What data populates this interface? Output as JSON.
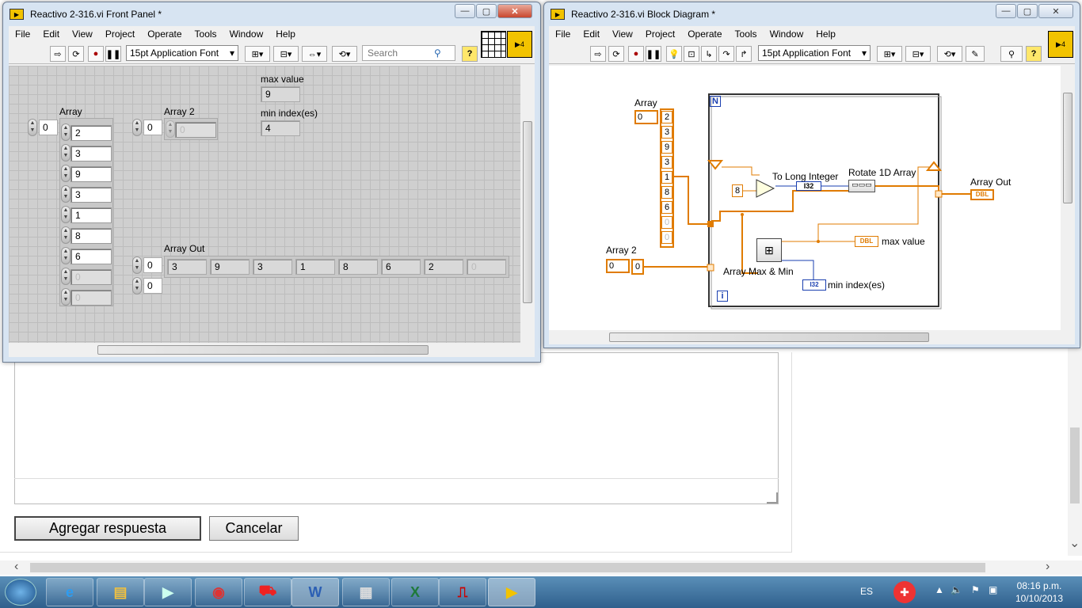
{
  "background_page": {
    "submit_button": "Agregar respuesta",
    "cancel_button": "Cancelar"
  },
  "front_panel": {
    "title": "Reactivo 2-316.vi Front Panel *",
    "menu": [
      "File",
      "Edit",
      "View",
      "Project",
      "Operate",
      "Tools",
      "Window",
      "Help"
    ],
    "font_select": "15pt Application Font",
    "search_placeholder": "Search",
    "array": {
      "label": "Array",
      "index": "0",
      "values": [
        "2",
        "3",
        "9",
        "3",
        "1",
        "8",
        "6",
        "0",
        "0"
      ]
    },
    "array2": {
      "label": "Array 2",
      "index": "0",
      "value": "0"
    },
    "max_value": {
      "label": "max value",
      "value": "9"
    },
    "min_index": {
      "label": "min index(es)",
      "value": "4"
    },
    "array_out": {
      "label": "Array Out",
      "index_row": "0",
      "index_col": "0",
      "values": [
        "3",
        "9",
        "3",
        "1",
        "8",
        "6",
        "2",
        "0"
      ]
    }
  },
  "block_diagram": {
    "title": "Reactivo 2-316.vi Block Diagram *",
    "menu": [
      "File",
      "Edit",
      "View",
      "Project",
      "Operate",
      "Tools",
      "Window",
      "Help"
    ],
    "font_select": "15pt Application Font",
    "array_label": "Array",
    "array_index": "0",
    "array_values": [
      "2",
      "3",
      "9",
      "3",
      "1",
      "8",
      "6",
      "0",
      "0"
    ],
    "array2_label": "Array 2",
    "array2_index": "0",
    "array2_value": "0",
    "loop_count": "N",
    "loop_iter": "i",
    "constant_8": "8",
    "to_long_integer": "To Long Integer",
    "i32_label": "I32",
    "rotate_1d_array": "Rotate 1D Array",
    "array_out_label": "Array Out",
    "dbl_label": "DBL",
    "max_value_label": "max value",
    "array_max_min": "Array Max & Min",
    "min_index_label": "min index(es)"
  },
  "taskbar": {
    "language": "ES",
    "time": "08:16 p.m.",
    "date": "10/10/2013"
  }
}
